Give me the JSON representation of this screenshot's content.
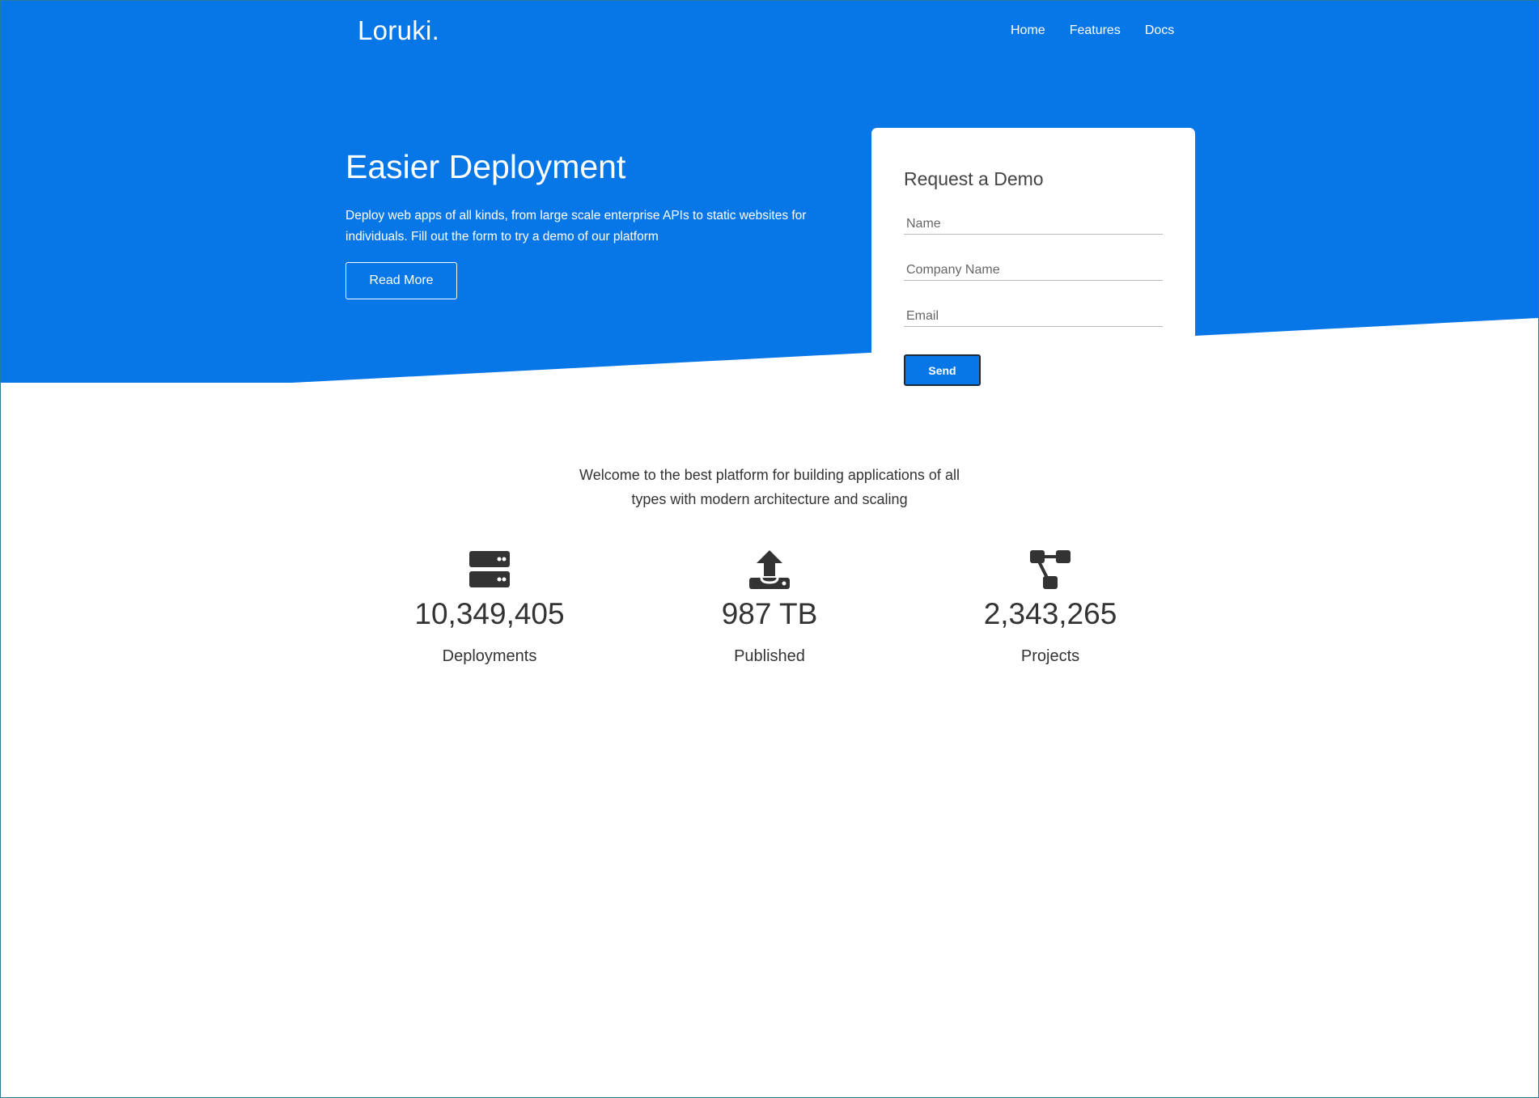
{
  "colors": {
    "brand_blue": "#0777e8",
    "text_dark": "#333333",
    "background": "#ffffff"
  },
  "nav": {
    "brand": "Loruki.",
    "links": [
      "Home",
      "Features",
      "Docs"
    ]
  },
  "hero": {
    "title": "Easier Deployment",
    "text": "Deploy web apps of all kinds, from large scale enterprise APIs to static websites for individuals. Fill out the form to try a demo of our platform",
    "button_label": "Read More"
  },
  "demo_form": {
    "title": "Request a Demo",
    "fields": [
      {
        "placeholder": "Name"
      },
      {
        "placeholder": "Company Name"
      },
      {
        "placeholder": "Email"
      }
    ],
    "submit_label": "Send"
  },
  "stats": {
    "intro": "Welcome to the best platform for building applications of all types with modern architecture and scaling",
    "items": [
      {
        "icon": "server-icon",
        "value": "10,349,405",
        "label": "Deployments"
      },
      {
        "icon": "upload-icon",
        "value": "987 TB",
        "label": "Published"
      },
      {
        "icon": "project-diagram-icon",
        "value": "2,343,265",
        "label": "Projects"
      }
    ]
  }
}
